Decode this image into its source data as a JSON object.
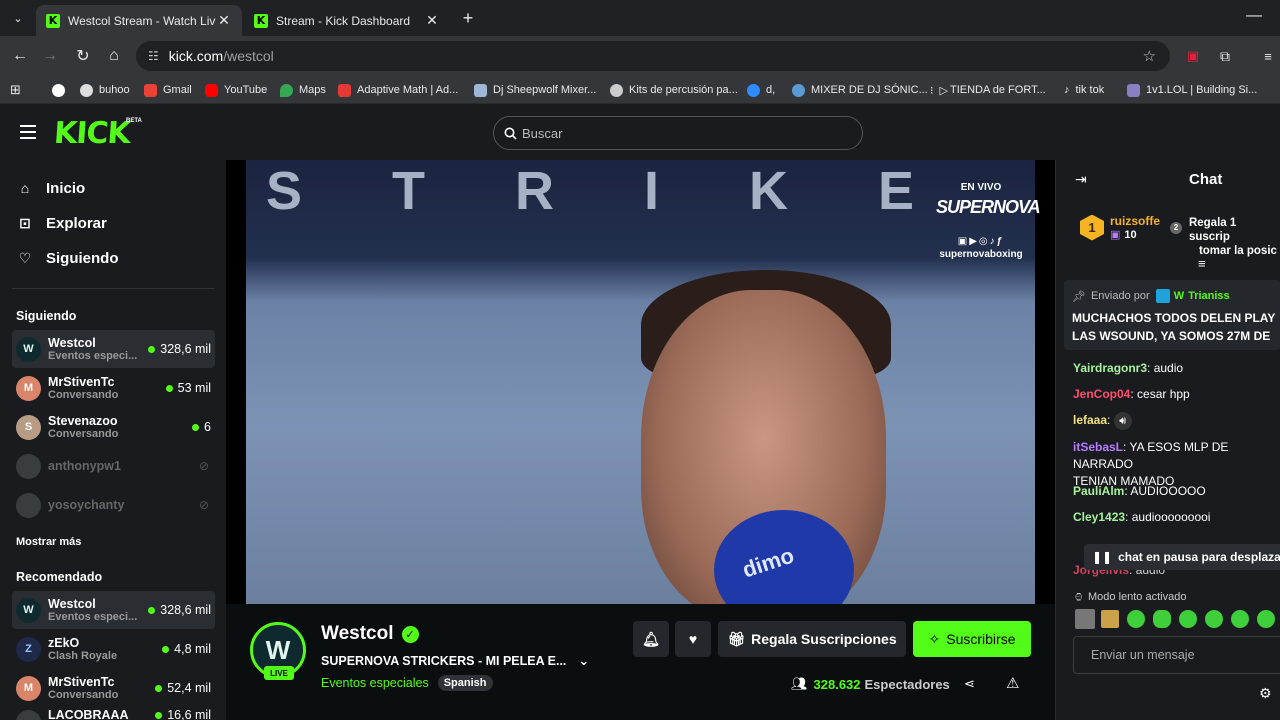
{
  "browser": {
    "tabs": [
      {
        "title": "Westcol Stream - Watch Live on",
        "active": true
      },
      {
        "title": "Stream - Kick Dashboard",
        "active": false
      }
    ],
    "url_host": "kick.com",
    "url_path": "/westcol",
    "bookmarks": [
      "buhoo",
      "Gmail",
      "YouTube",
      "Maps",
      "Adaptive Math | Ad...",
      "Dj Sheepwolf Mixer...",
      "Kits de percusión pa...",
      "d,",
      "MIXER DE DJ SÓNIC...",
      "TIENDA de FORT...",
      "tik tok",
      "1v1.LOL | Building Si..."
    ]
  },
  "header": {
    "logo": "KICK",
    "beta": "BETA",
    "search_placeholder": "Buscar"
  },
  "sidebar": {
    "nav": [
      "Inicio",
      "Explorar",
      "Siguiendo"
    ],
    "following_title": "Siguiendo",
    "following": [
      {
        "name": "Westcol",
        "category": "Eventos especi...",
        "viewers": "328,6 mil"
      },
      {
        "name": "MrStivenTc",
        "category": "Conversando",
        "viewers": "53 mil"
      },
      {
        "name": "Stevenazoo",
        "category": "Conversando",
        "viewers": "6"
      },
      {
        "name": "anthonypw1"
      },
      {
        "name": "yosoychanty"
      }
    ],
    "show_more": "Mostrar más",
    "recommended_title": "Recomendado",
    "recommended": [
      {
        "name": "Westcol",
        "category": "Eventos especi...",
        "viewers": "328,6 mil"
      },
      {
        "name": "zEkO",
        "category": "Clash Royale",
        "viewers": "4,8 mil"
      },
      {
        "name": "MrStivenTc",
        "category": "Conversando",
        "viewers": "52,4 mil"
      },
      {
        "name": "LACOBRAAA",
        "viewers": "16,6 mil"
      }
    ]
  },
  "player": {
    "overlay_top": "EN VIVO",
    "overlay_brand": "SUPERNOVA",
    "overlay_handle": "supernovaboxing",
    "background_text": "STRIKE",
    "mic_text": "dimo"
  },
  "stream": {
    "channel": "Westcol",
    "live": "LIVE",
    "title": "SUPERNOVA STRICKERS - MI PELEA E...",
    "category": "Eventos especiales",
    "language": "Spanish",
    "gift_label": "Regala Suscripciones",
    "subscribe_label": "Suscribirse",
    "viewers": "328.632",
    "viewers_label": "Espectadores"
  },
  "chat": {
    "title": "Chat",
    "top_gifter": {
      "rank": "1",
      "name": "ruizsoffe",
      "count": "10"
    },
    "gift_promo_line1": "Regala 1 suscrip",
    "gift_promo_line2": "tomar la posic",
    "pinned_label": "Enviado por",
    "pinned_by": "Trianiss",
    "pinned_line1": "MUCHACHOS TODOS DELEN PLAY",
    "pinned_line2": "LAS WSOUND, YA SOMOS 27M DE",
    "messages": [
      {
        "user": "Yairdragonr3",
        "text": "audio",
        "color": "#a6f29b"
      },
      {
        "user": "JenCop04",
        "text": "cesar hpp",
        "color": "#ff4d6d"
      },
      {
        "user": "lefaaa",
        "text": "",
        "color": "#f5e27c"
      },
      {
        "user": "itSebasL",
        "text": "YA ESOS MLP DE NARRADO",
        "text2": "TENIAN MAMADO",
        "color": "#b77cff"
      },
      {
        "user": "PauliAlm",
        "text": "AUDIOOOOO",
        "color": "#a6f29b"
      },
      {
        "user": "Cley1423",
        "text": "audiooooooooi",
        "color": "#a6f29b"
      },
      {
        "user": "Jorgelivis",
        "text": "audio",
        "color": "#ff4d6d"
      }
    ],
    "paused_notice": "chat en pausa para desplazar",
    "slow_mode": "Modo lento activado",
    "input_placeholder": "Enviar un mensaje"
  },
  "colors": {
    "accent": "#53fc18",
    "panel": "#191b1f",
    "page": "#0b0e0f"
  }
}
